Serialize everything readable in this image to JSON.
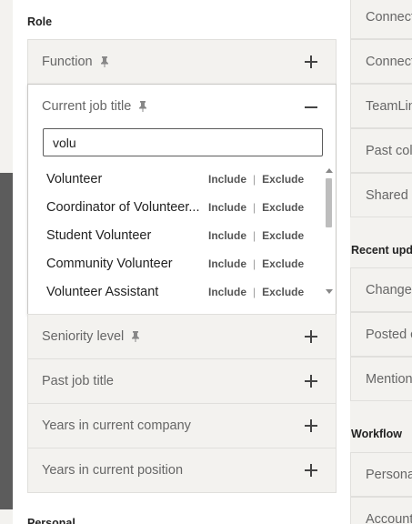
{
  "role_section": {
    "heading": "Role",
    "filters_top": [
      {
        "label": "Function",
        "pinned": true,
        "state": "collapsed"
      }
    ],
    "open_filter": {
      "label": "Current job title",
      "pinned": true,
      "search_value": "volu",
      "results": [
        {
          "name": "Volunteer",
          "include": "Include",
          "exclude": "Exclude"
        },
        {
          "name": "Coordinator of Volunteer...",
          "include": "Include",
          "exclude": "Exclude"
        },
        {
          "name": "Student Volunteer",
          "include": "Include",
          "exclude": "Exclude"
        },
        {
          "name": "Community Volunteer",
          "include": "Include",
          "exclude": "Exclude"
        },
        {
          "name": "Volunteer Assistant",
          "include": "Include",
          "exclude": "Exclude"
        }
      ],
      "separator": "|"
    },
    "filters_bottom": [
      {
        "label": "Seniority level",
        "pinned": true
      },
      {
        "label": "Past job title",
        "pinned": false
      },
      {
        "label": "Years in current company",
        "pinned": false
      },
      {
        "label": "Years in current position",
        "pinned": false
      }
    ]
  },
  "next_section_heading": "Personal",
  "right_column": {
    "group1": [
      "Connect",
      "Connect",
      "TeamLin",
      "Past col",
      "Shared c"
    ],
    "recent_heading": "Recent upd",
    "group2": [
      "Change",
      "Posted c",
      "Mention"
    ],
    "workflow_heading": "Workflow",
    "group3": [
      "Persona",
      "Account"
    ]
  },
  "colors": {
    "panel_bg": "#ffffff",
    "card_bg": "#f3f2ef",
    "border": "#e0dfdc",
    "text_muted": "#666666",
    "text_dark": "#222222"
  },
  "icons": {
    "pin": "pin-icon",
    "expand": "plus-icon",
    "collapse": "minus-icon"
  }
}
